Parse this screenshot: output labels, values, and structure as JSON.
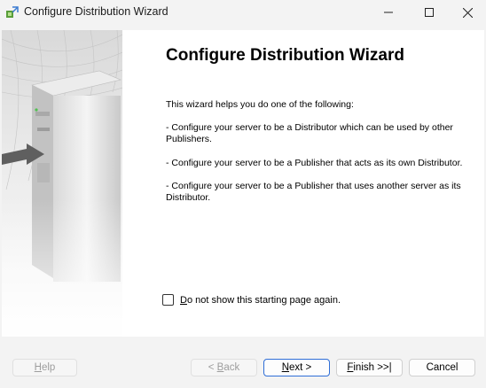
{
  "window": {
    "title": "Configure Distribution Wizard"
  },
  "page": {
    "heading": "Configure Distribution Wizard",
    "intro": "This wizard helps you do one of the following:",
    "bullets": [
      " - Configure your server to be a Distributor which can be used by other Publishers.",
      " - Configure your server to be a Publisher that acts as its own Distributor.",
      " - Configure your server to be a Publisher that uses another server as its Distributor."
    ],
    "checkbox": {
      "label_mnemonic": "D",
      "label_rest": "o not show this starting page again.",
      "checked": false
    }
  },
  "buttons": {
    "help": {
      "mnemonic": "H",
      "rest": "elp",
      "enabled": false
    },
    "back": {
      "prefix": "< ",
      "mnemonic": "B",
      "rest": "ack",
      "enabled": false
    },
    "next": {
      "mnemonic": "N",
      "rest": "ext >",
      "enabled": true
    },
    "finish": {
      "mnemonic": "F",
      "rest": "inish >>|",
      "enabled": true
    },
    "cancel": {
      "label": "Cancel",
      "enabled": true
    }
  },
  "icons": {
    "app": "wizard-icon",
    "minimize": "minimize-icon",
    "maximize": "maximize-icon",
    "close": "close-icon"
  },
  "colors": {
    "primary_border": "#2f6ed7",
    "disabled_text": "#9d9d9d"
  }
}
